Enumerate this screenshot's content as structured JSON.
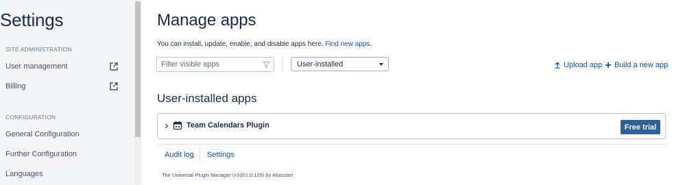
{
  "sidebar": {
    "title": "Settings",
    "sections": [
      {
        "heading": "SITE ADMINISTRATION",
        "items": [
          {
            "label": "User management",
            "icon": "external-link-icon"
          },
          {
            "label": "Billing",
            "icon": "external-link-icon"
          }
        ]
      },
      {
        "heading": "CONFIGURATION",
        "items": [
          {
            "label": "General Configuration"
          },
          {
            "label": "Further Configuration"
          },
          {
            "label": "Languages"
          }
        ]
      }
    ]
  },
  "main": {
    "title": "Manage apps",
    "intro_text": "You can install, update, enable, and disable apps here.",
    "intro_link": "Find new apps.",
    "filter": {
      "placeholder": "Filter visible apps",
      "value": "",
      "icon": "funnel-icon"
    },
    "select": {
      "selected": "User-installed"
    },
    "actions": {
      "upload": "Upload app",
      "build": "Build a new app"
    },
    "section_title": "User-installed apps",
    "plugins": [
      {
        "name": "Team Calendars Plugin",
        "icon": "calendar-icon",
        "button": "Free trial"
      }
    ],
    "footer": {
      "links": [
        "Audit log",
        "Settings"
      ],
      "credit": "The Universal Plugin Manager (v1001.0.129) by Atlassian"
    }
  },
  "colors": {
    "accent_link": "#0052cc",
    "primary_button": "#2e5f9e",
    "sidebar_bg": "#f4f5f7",
    "text": "#172b4d"
  }
}
